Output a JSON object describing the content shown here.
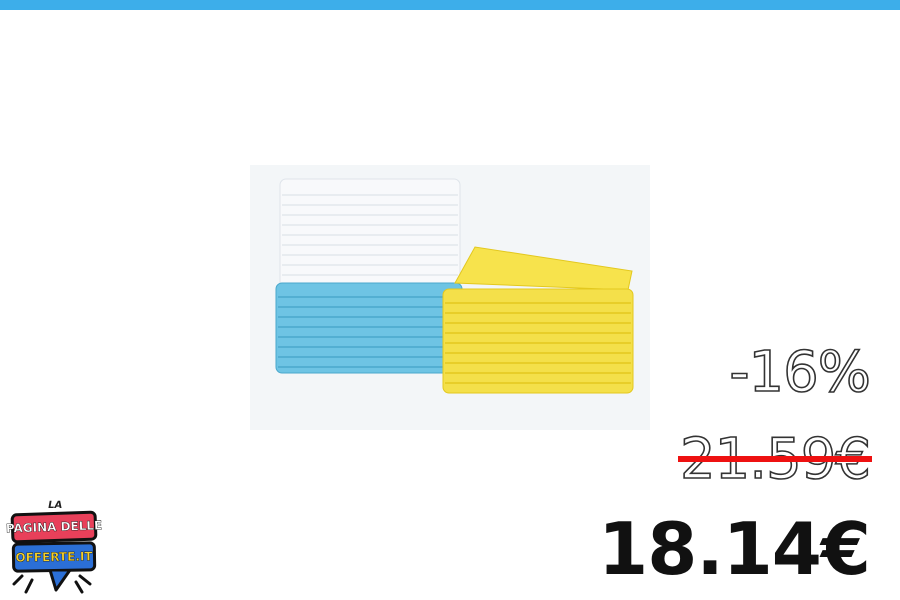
{
  "colors": {
    "top_bar": "#3daeea",
    "strike_line": "#ee1111",
    "logo_red": "#e8405a",
    "logo_blue": "#2b6fd6",
    "logo_yellow": "#f6d02a"
  },
  "product": {
    "image_icon": "microfiber-towels-stack-image",
    "colors": [
      "#ffffff",
      "#6ec4e4",
      "#f4e04a"
    ]
  },
  "pricing": {
    "discount": "-16%",
    "old_price": "21.59€",
    "new_price": "18.14€"
  },
  "logo": {
    "line1": "LA",
    "line2": "PAGINA DELLE",
    "line3": "OFFERTE.IT"
  }
}
